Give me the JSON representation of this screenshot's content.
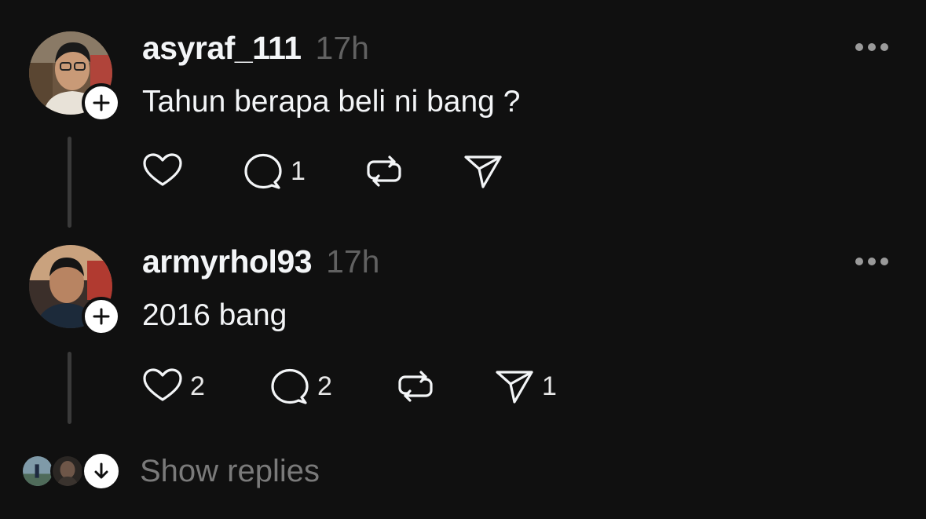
{
  "comments": [
    {
      "username": "asyraf_111",
      "time": "17h",
      "text": "Tahun berapa beli ni bang ?",
      "avatar": "user-avatar-photo",
      "counts": {
        "like": "",
        "reply": "1",
        "repost": "",
        "share": ""
      }
    },
    {
      "username": "armyrhol93",
      "time": "17h",
      "text": "2016 bang",
      "avatar": "user-avatar-photo",
      "counts": {
        "like": "2",
        "reply": "2",
        "repost": "",
        "share": "1"
      }
    }
  ],
  "show_replies": {
    "label": "Show replies"
  },
  "icons": {
    "like": "heart-icon",
    "reply": "comment-icon",
    "repost": "repost-icon",
    "share": "send-icon",
    "follow": "plus-icon",
    "more": "more-icon",
    "expand": "arrow-down-icon"
  },
  "colors": {
    "background": "#101010",
    "text": "#f3f5f7",
    "secondary": "#616161",
    "thread_line": "#3a3a3a"
  }
}
